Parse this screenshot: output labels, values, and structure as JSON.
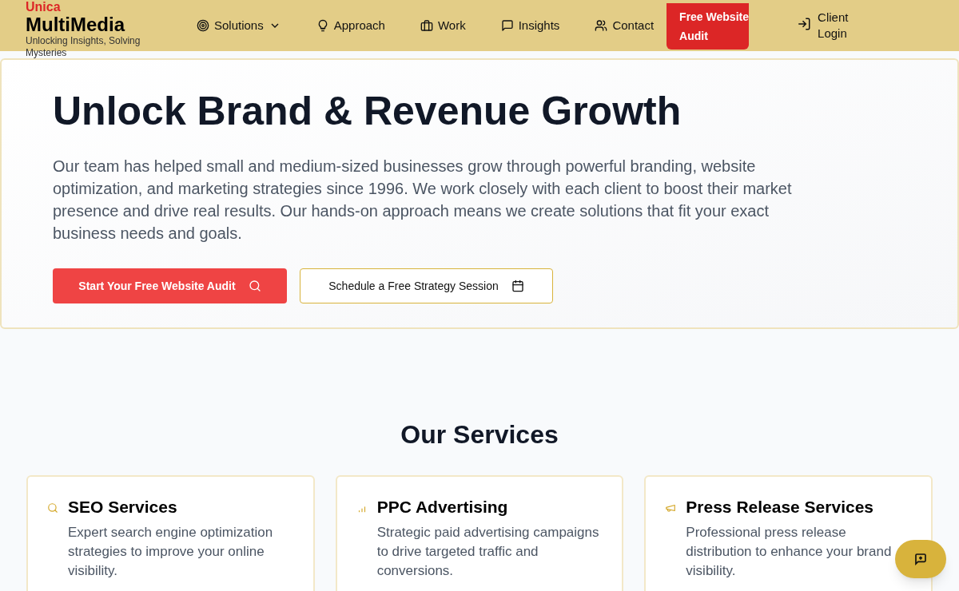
{
  "header": {
    "logo_top": "Unica",
    "logo": "MultiMedia",
    "tagline": "Unlocking Insights, Solving Mysteries",
    "nav": [
      {
        "label": "Solutions",
        "dropdown": true
      },
      {
        "label": "Approach",
        "dropdown": false
      },
      {
        "label": "Work",
        "dropdown": false
      },
      {
        "label": "Insights",
        "dropdown": false
      },
      {
        "label": "Contact",
        "dropdown": false
      }
    ],
    "cta": "Free Website Audit",
    "login": "Client Login"
  },
  "hero": {
    "title": "Unlock Brand & Revenue Growth",
    "text": "Our team has helped small and medium-sized businesses grow through powerful branding, website optimization, and marketing strategies since 1996. We work closely with each client to boost their market presence and drive real results. Our hands-on approach means we create solutions that fit your exact business needs and goals.",
    "buttons": [
      {
        "label": "Start Your Free Website Audit",
        "kind": "primary"
      },
      {
        "label": "Schedule a Free Strategy Session",
        "kind": "outline"
      }
    ]
  },
  "services": {
    "title": "Our Services",
    "cards": [
      {
        "title": "SEO Services",
        "text": "Expert search engine optimization strategies to improve your online visibility."
      },
      {
        "title": "PPC Advertising",
        "text": "Strategic paid advertising campaigns to drive targeted traffic and conversions."
      },
      {
        "title": "Press Release Services",
        "text": "Professional press release distribution to enhance your brand visibility."
      }
    ]
  }
}
